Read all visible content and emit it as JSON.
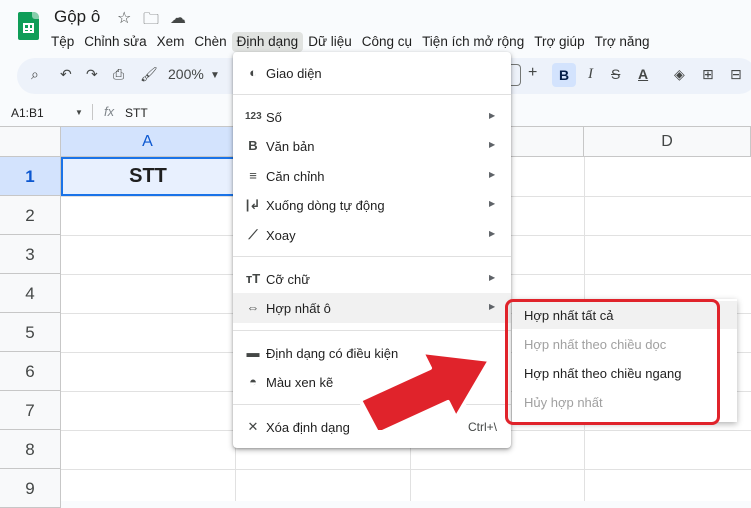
{
  "app": {
    "doc_title": "Gộp ô"
  },
  "menubar": [
    "Tệp",
    "Chỉnh sửa",
    "Xem",
    "Chèn",
    "Định dạng",
    "Dữ liệu",
    "Công cụ",
    "Tiện ích mở rộng",
    "Trợ giúp",
    "Trợ năng"
  ],
  "toolbar": {
    "zoom": "200%",
    "bold": "B",
    "italic": "I"
  },
  "formula_bar": {
    "range": "A1:B1",
    "value": "STT"
  },
  "columns": [
    "A",
    "D"
  ],
  "rows": [
    "1",
    "2",
    "3",
    "4",
    "5",
    "6",
    "7",
    "8",
    "9"
  ],
  "cells": {
    "A1": "STT"
  },
  "format_menu": {
    "items": [
      {
        "label": "Giao diện",
        "icon": "palette-icon"
      },
      {
        "label": "Số",
        "icon": "123-icon"
      },
      {
        "label": "Văn bản",
        "icon": "bold-icon"
      },
      {
        "label": "Căn chỉnh",
        "icon": "align-icon"
      },
      {
        "label": "Xuống dòng tự động",
        "icon": "wrap-icon"
      },
      {
        "label": "Xoay",
        "icon": "rotate-icon"
      },
      {
        "label": "Cỡ chữ",
        "icon": "font-size-icon"
      },
      {
        "label": "Hợp nhất ô",
        "icon": "merge-icon"
      },
      {
        "label": "Định dạng có điều kiện",
        "icon": "paint-roller-icon"
      },
      {
        "label": "Màu xen kẽ",
        "icon": "fill-drop-icon"
      },
      {
        "label": "Xóa định dạng",
        "icon": "clear-format-icon",
        "shortcut": "Ctrl+\\"
      }
    ]
  },
  "merge_submenu": [
    {
      "label": "Hợp nhất tất cả",
      "enabled": true
    },
    {
      "label": "Hợp nhất theo chiều dọc",
      "enabled": false
    },
    {
      "label": "Hợp nhất theo chiều ngang",
      "enabled": true
    },
    {
      "label": "Hủy hợp nhất",
      "enabled": false
    }
  ],
  "colors": {
    "accent": "#e0232b",
    "selection": "#1a73e8",
    "sheets_green": "#0f9d58"
  }
}
